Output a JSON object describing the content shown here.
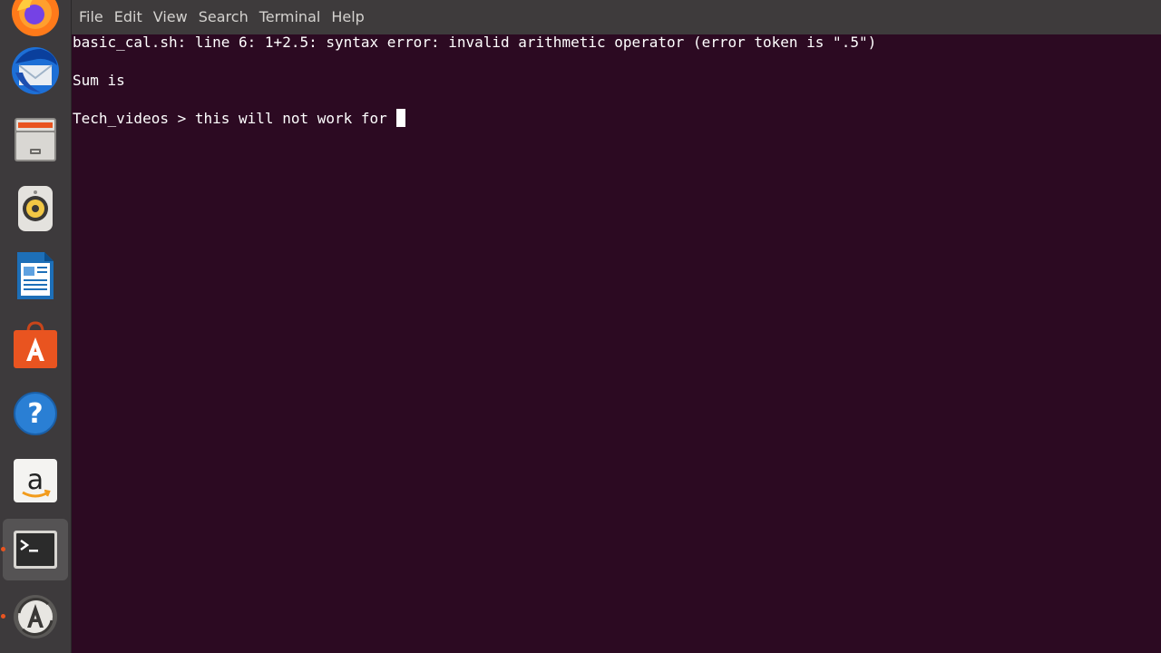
{
  "dock": {
    "items": [
      {
        "name": "Firefox",
        "icon": "firefox-icon"
      },
      {
        "name": "Thunderbird",
        "icon": "thunderbird-icon"
      },
      {
        "name": "Files",
        "icon": "files-icon"
      },
      {
        "name": "Rhythmbox",
        "icon": "rhythmbox-icon"
      },
      {
        "name": "LibreOffice Writer",
        "icon": "writer-icon"
      },
      {
        "name": "Ubuntu Software",
        "icon": "software-center-icon"
      },
      {
        "name": "Help",
        "icon": "help-icon"
      },
      {
        "name": "Amazon",
        "icon": "amazon-icon"
      },
      {
        "name": "Terminal",
        "icon": "terminal-icon",
        "active": true
      },
      {
        "name": "Software Updater",
        "icon": "software-updater-icon"
      }
    ]
  },
  "terminal": {
    "menu": {
      "file": "File",
      "edit": "Edit",
      "view": "View",
      "search": "Search",
      "terminal": "Terminal",
      "help": "Help"
    },
    "output": {
      "error_line": "basic_cal.sh: line 6: 1+2.5: syntax error: invalid arithmetic operator (error token is \".5\")",
      "sum_line": "Sum is",
      "prompt_line": "Tech_videos > this will not work for "
    }
  },
  "colors": {
    "terminal_bg": "#2c0a22",
    "dock_bg": "#3d3a3c",
    "menubar_bg": "#3e3b3c",
    "accent": "#e95420"
  }
}
